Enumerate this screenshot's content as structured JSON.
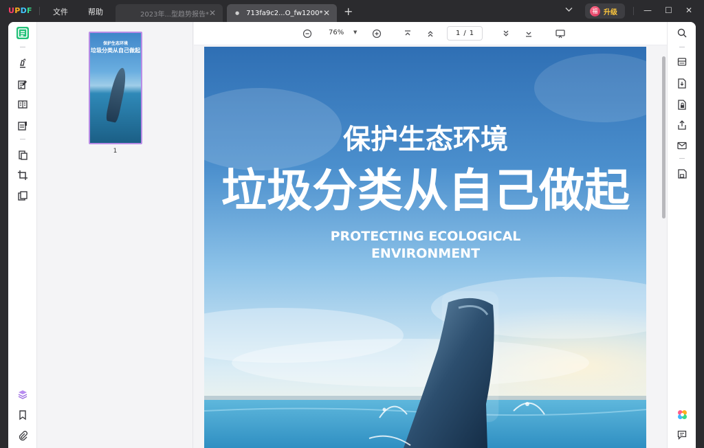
{
  "titlebar": {
    "logo": {
      "u": "U",
      "p": "P",
      "d": "D",
      "f": "F"
    },
    "menu": {
      "file": "文件",
      "help": "帮助"
    },
    "tabs": [
      {
        "label": "2023年...型趋势报告*",
        "active": false
      },
      {
        "label": "713fa9c2...O_fw1200*",
        "active": true
      }
    ],
    "new_tab": "+",
    "upgrade": {
      "badge": "福",
      "label": "升级"
    },
    "window": {
      "minimize": "—",
      "maximize": "☐",
      "close": "✕"
    }
  },
  "toolbar": {
    "zoom": "76%",
    "page_current": "1",
    "page_separator": "/",
    "page_total": "1"
  },
  "thumbnails": [
    {
      "page": "1",
      "title_small": "保护生态环境",
      "title_big": "垃圾分类从自己做起"
    }
  ],
  "document": {
    "headline_small": "保护生态环境",
    "headline_big": "垃圾分类从自己做起",
    "subtitle_line1": "PROTECTING ECOLOGICAL",
    "subtitle_line2": "ENVIRONMENT"
  },
  "colors": {
    "accent_green": "#22c178",
    "upgrade_text": "#ffc83d",
    "titlebar_bg": "#2b2b2e",
    "thumb_border": "#b98ce6"
  },
  "icons": {
    "left_rail": [
      "reader-icon",
      "comment-highlighter-icon",
      "edit-text-icon",
      "organize-pages-icon",
      "form-icon",
      "convert-icon",
      "crop-icon",
      "batch-icon",
      "layers-icon",
      "bookmark-icon",
      "attachment-icon"
    ],
    "right_rail": [
      "search-icon",
      "ocr-icon",
      "convert-pdf-icon",
      "protect-icon",
      "share-icon",
      "email-icon",
      "save-icon",
      "ai-assistant-icon",
      "comments-panel-icon"
    ]
  }
}
